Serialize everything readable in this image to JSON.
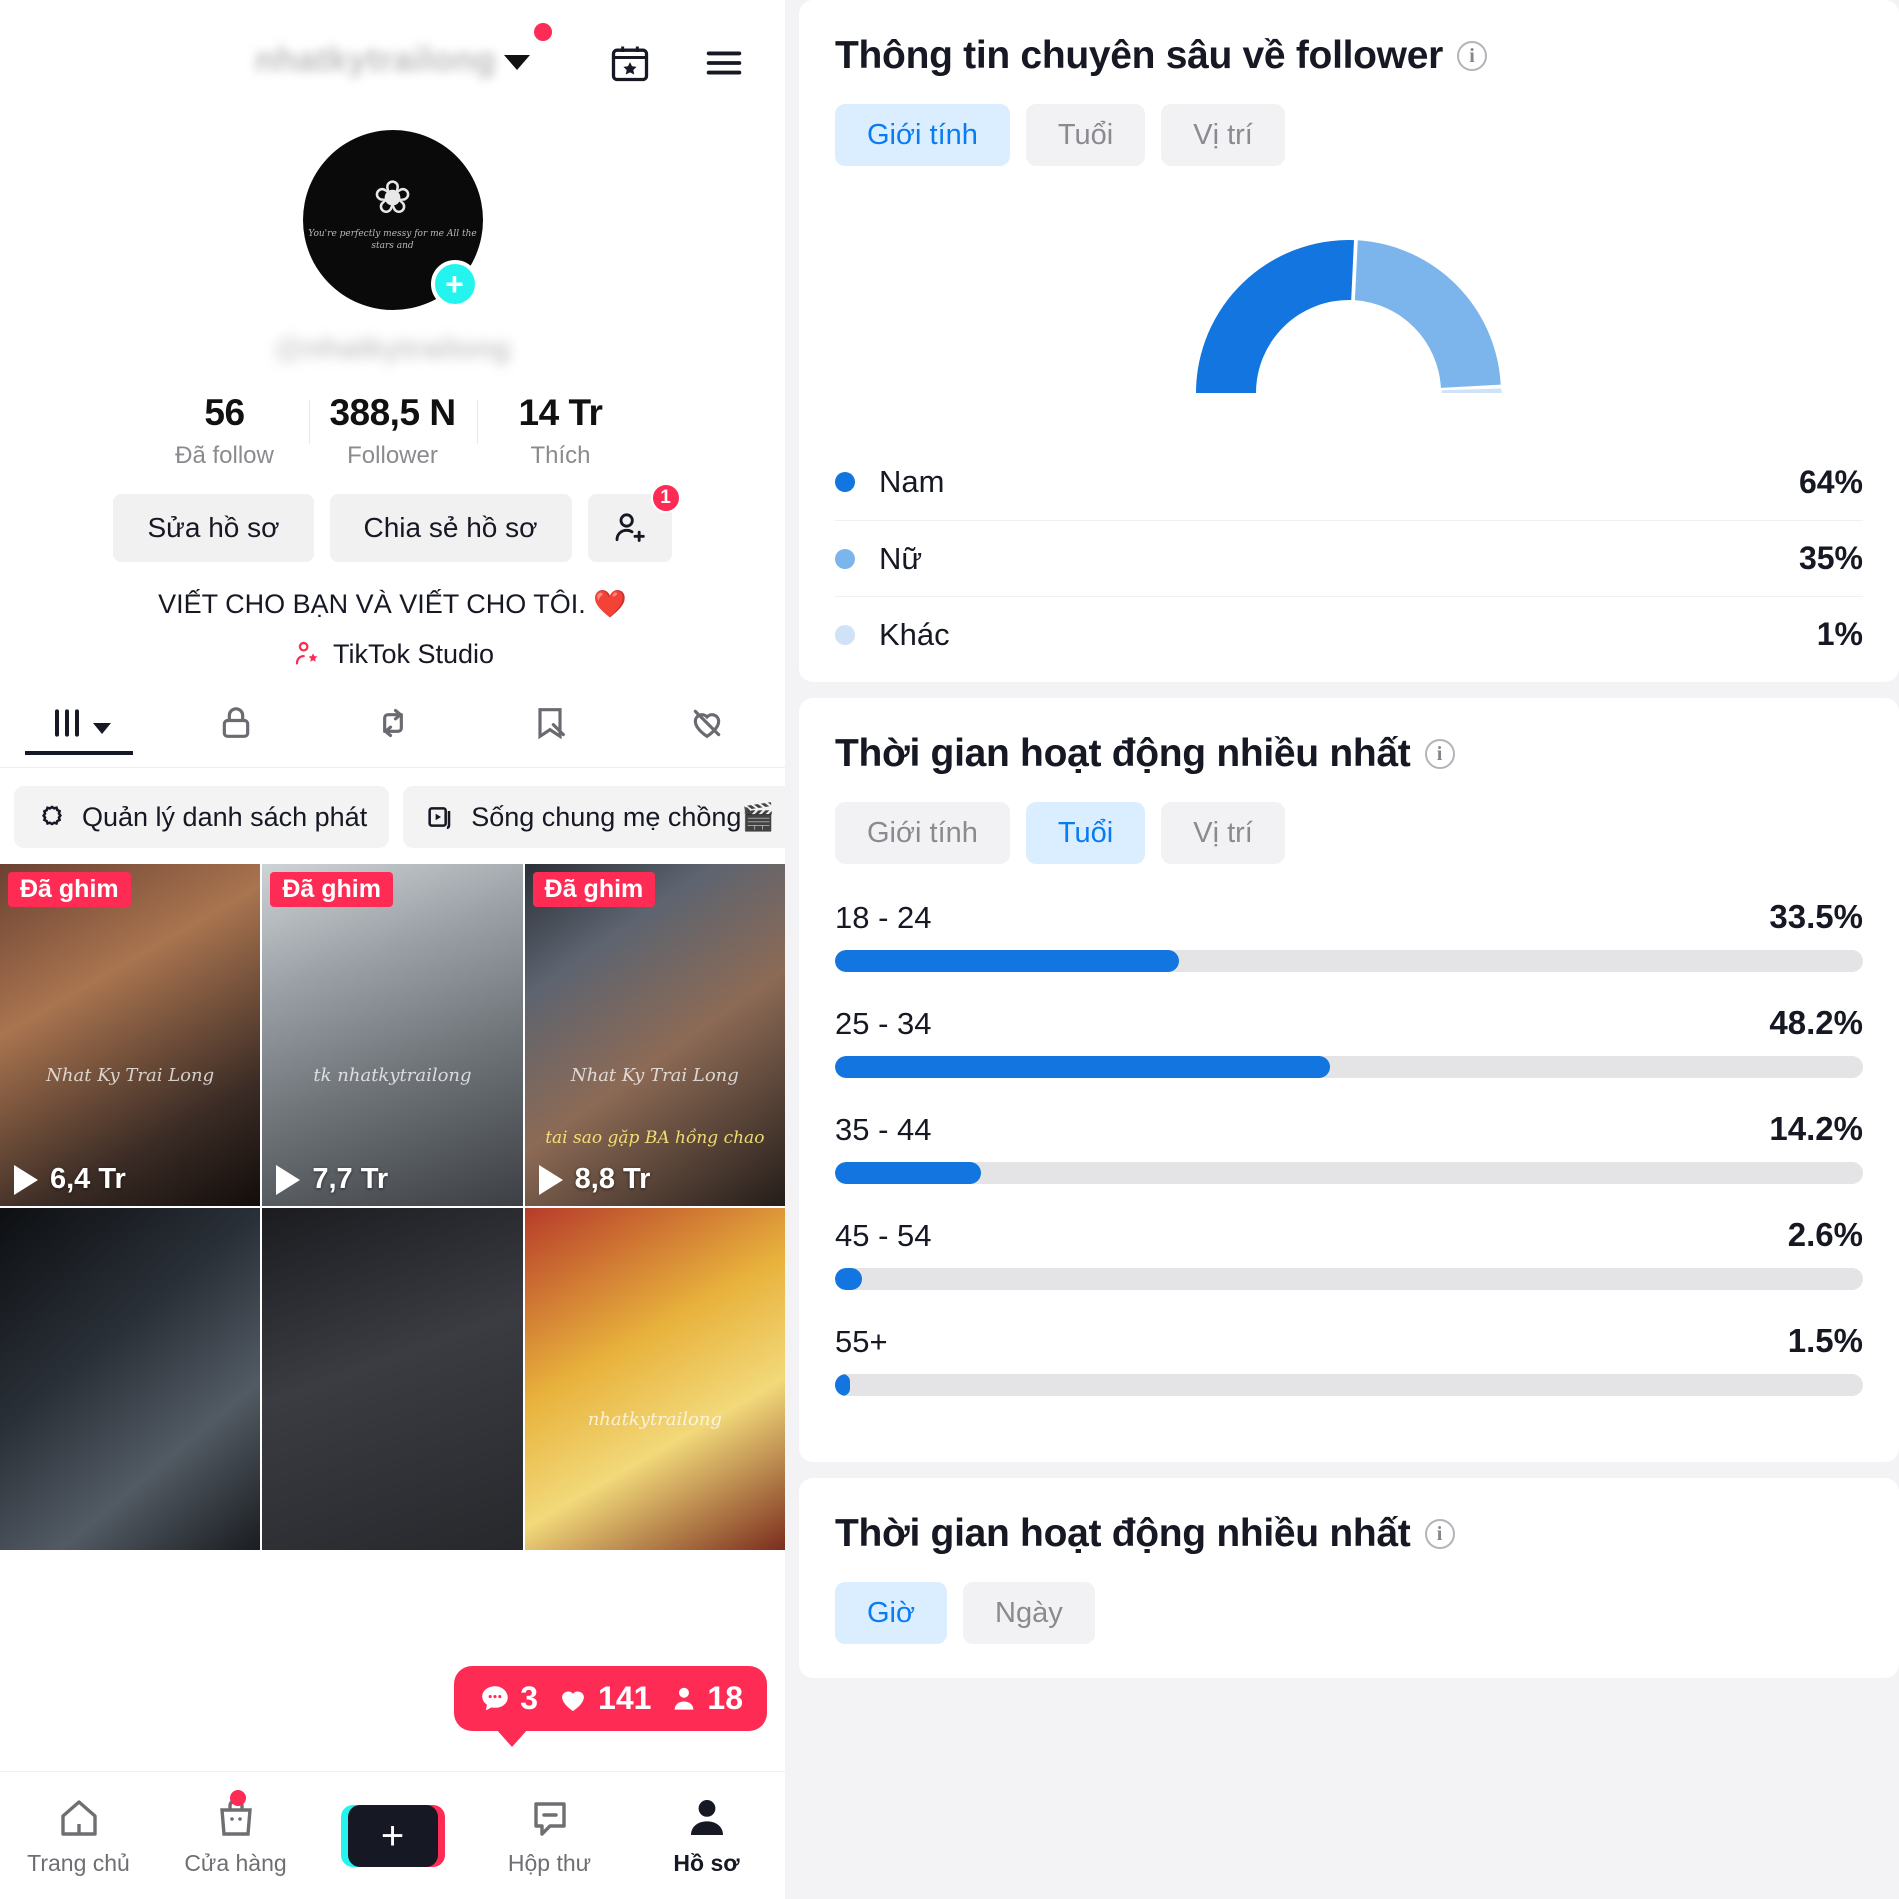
{
  "profile": {
    "username_obscured": "nhatkytrailong",
    "handle_obscured": "@nhatkytrailong",
    "avatar_rose": "❀",
    "avatar_script": "You're perfectly messy\nfor me\nAll the stars\nand",
    "plus_badge": "+",
    "stats": [
      {
        "num": "56",
        "label": "Đã follow"
      },
      {
        "num": "388,5 N",
        "label": "Follower"
      },
      {
        "num": "14 Tr",
        "label": "Thích"
      }
    ],
    "actions": {
      "edit_profile": "Sửa hồ sơ",
      "share_profile": "Chia sẻ hồ sơ",
      "add_friend_badge": "1"
    },
    "bio": "VIẾT CHO BẠN VÀ VIẾT CHO TÔI. ❤️",
    "studio_label": "TikTok Studio",
    "content_tabs": [
      {
        "icon": "grid-posts-icon",
        "active": true
      },
      {
        "icon": "lock-private-icon",
        "active": false
      },
      {
        "icon": "repost-icon",
        "active": false
      },
      {
        "icon": "saved-icon",
        "active": false
      },
      {
        "icon": "liked-hidden-icon",
        "active": false
      }
    ],
    "chips": [
      {
        "icon": "playlist-gear-icon",
        "label": "Quản lý danh sách phát"
      },
      {
        "icon": "playlist-stack-icon",
        "label": "Sống chung mẹ chồng🎬"
      }
    ],
    "grid": [
      {
        "pinned": "Đã ghim",
        "views": "6,4 Tr",
        "watermark": "Nhat Ky Trai Long",
        "wm2": ""
      },
      {
        "pinned": "Đã ghim",
        "views": "7,7 Tr",
        "watermark": "tk nhatkytrailong",
        "wm2": ""
      },
      {
        "pinned": "Đã ghim",
        "views": "8,8 Tr",
        "watermark": "Nhat Ky Trai Long",
        "wm2": "tai sao gặp BA hồng chao"
      },
      {
        "pinned": "",
        "views": "",
        "watermark": "",
        "wm2": ""
      },
      {
        "pinned": "",
        "views": "",
        "watermark": "",
        "wm2": ""
      },
      {
        "pinned": "",
        "views": "",
        "watermark": "nhatkytrailong",
        "wm2": ""
      }
    ],
    "engagement_pill": {
      "comments": "3",
      "likes": "141",
      "viewers": "18"
    },
    "bottom_nav": [
      {
        "icon": "home-icon",
        "label": "Trang chủ",
        "active": false,
        "dot": false
      },
      {
        "icon": "shop-bag-icon",
        "label": "Cửa hàng",
        "active": false,
        "dot": true
      },
      {
        "icon": "create-plus-icon",
        "label": "",
        "active": false,
        "dot": false
      },
      {
        "icon": "inbox-icon",
        "label": "Hộp thư",
        "active": false,
        "dot": false
      },
      {
        "icon": "profile-person-icon",
        "label": "Hồ sơ",
        "active": true,
        "dot": false
      }
    ]
  },
  "analytics": {
    "follower_insights": {
      "title": "Thông tin chuyên sâu về follower",
      "tabs": [
        {
          "label": "Giới tính",
          "active": true
        },
        {
          "label": "Tuổi",
          "active": false
        },
        {
          "label": "Vị trí",
          "active": false
        }
      ]
    },
    "most_active_age": {
      "title": "Thời gian hoạt động nhiều nhất",
      "tabs": [
        {
          "label": "Giới tính",
          "active": false
        },
        {
          "label": "Tuổi",
          "active": true
        },
        {
          "label": "Vị trí",
          "active": false
        }
      ]
    },
    "most_active_time": {
      "title": "Thời gian hoạt động nhiều nhất",
      "tabs": [
        {
          "label": "Giờ",
          "active": true
        },
        {
          "label": "Ngày",
          "active": false
        }
      ]
    },
    "colors": {
      "primary_blue": "#1275e0",
      "mid_blue": "#7cb4ec",
      "light_blue": "#cfe2f7",
      "track_grey": "#e4e4e7",
      "accent_pink": "#fe2c55",
      "tab_active_bg": "#dbeeff",
      "tab_active_text": "#0a7cf2"
    }
  },
  "chart_data": [
    {
      "type": "pie",
      "title": "Thông tin chuyên sâu về follower",
      "subtype": "semi-donut-gauge",
      "categories": [
        "Nam",
        "Nữ",
        "Khác"
      ],
      "values": [
        64,
        35,
        1
      ],
      "labels": [
        "64%",
        "35%",
        "1%"
      ],
      "colors": [
        "#1275e0",
        "#7cb4ec",
        "#cfe2f7"
      ],
      "legend": "bottom-list",
      "unit": "%"
    },
    {
      "type": "bar",
      "orientation": "horizontal",
      "title": "Thời gian hoạt động nhiều nhất",
      "categories": [
        "18 - 24",
        "25 - 34",
        "35 - 44",
        "45 - 54",
        "55+"
      ],
      "values": [
        33.5,
        48.2,
        14.2,
        2.6,
        1.5
      ],
      "labels": [
        "33.5%",
        "48.2%",
        "14.2%",
        "2.6%",
        "1.5%"
      ],
      "xlabel": "",
      "ylabel": "",
      "xlim": [
        0,
        100
      ],
      "grid": false,
      "legend": "none",
      "bar_color": "#1275e0",
      "track_color": "#e4e4e7",
      "unit": "%"
    }
  ]
}
